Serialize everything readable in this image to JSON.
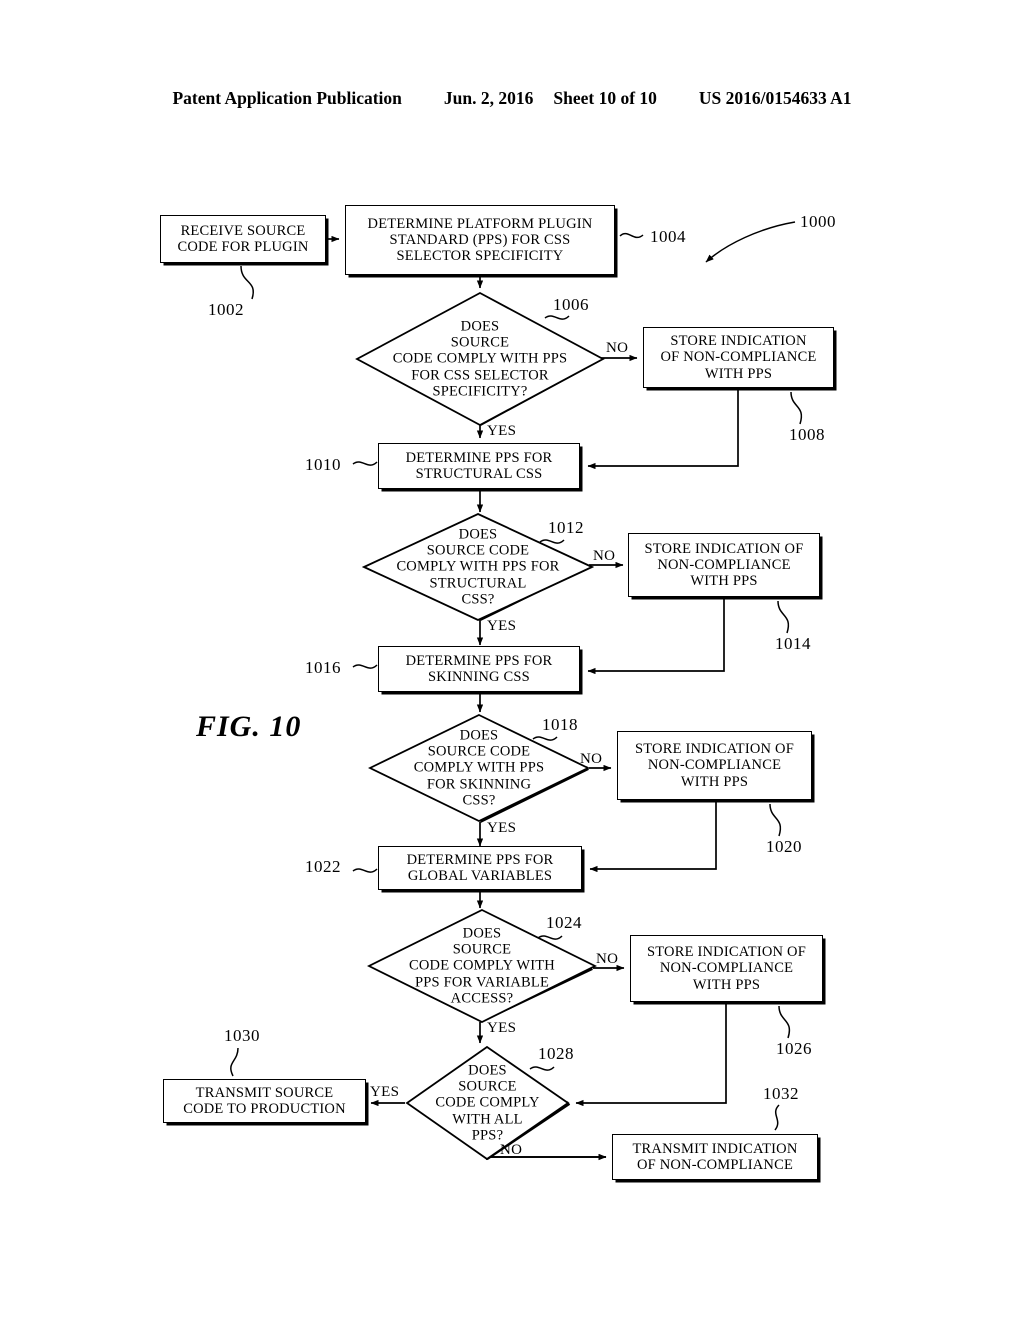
{
  "header": {
    "publication": "Patent Application Publication",
    "date": "Jun. 2, 2016",
    "sheet": "Sheet 10 of 10",
    "patent_number": "US 2016/0154633 A1"
  },
  "figure": {
    "label": "FIG. 10",
    "overall_ref": "1000"
  },
  "nodes": [
    {
      "id": "n1002",
      "ref": "1002",
      "shape": "process",
      "text": "RECEIVE SOURCE\nCODE FOR PLUGIN"
    },
    {
      "id": "n1004",
      "ref": "1004",
      "shape": "process",
      "text": "DETERMINE PLATFORM PLUGIN\nSTANDARD (PPS) FOR CSS\nSELECTOR SPECIFICITY"
    },
    {
      "id": "n1006",
      "ref": "1006",
      "shape": "decision",
      "text": "DOES\nSOURCE\nCODE COMPLY WITH PPS\nFOR CSS SELECTOR\nSPECIFICITY?"
    },
    {
      "id": "n1008",
      "ref": "1008",
      "shape": "process",
      "text": "STORE INDICATION\nOF NON-COMPLIANCE\nWITH PPS"
    },
    {
      "id": "n1010",
      "ref": "1010",
      "shape": "process",
      "text": "DETERMINE PPS FOR\nSTRUCTURAL CSS"
    },
    {
      "id": "n1012",
      "ref": "1012",
      "shape": "decision",
      "text": "DOES\nSOURCE CODE\nCOMPLY WITH PPS FOR\nSTRUCTURAL\nCSS?"
    },
    {
      "id": "n1014",
      "ref": "1014",
      "shape": "process",
      "text": "STORE INDICATION OF\nNON-COMPLIANCE\nWITH PPS"
    },
    {
      "id": "n1016",
      "ref": "1016",
      "shape": "process",
      "text": "DETERMINE PPS FOR\nSKINNING CSS"
    },
    {
      "id": "n1018",
      "ref": "1018",
      "shape": "decision",
      "text": "DOES\nSOURCE CODE\nCOMPLY WITH PPS\nFOR SKINNING\nCSS?"
    },
    {
      "id": "n1020",
      "ref": "1020",
      "shape": "process",
      "text": "STORE INDICATION OF\nNON-COMPLIANCE\nWITH PPS"
    },
    {
      "id": "n1022",
      "ref": "1022",
      "shape": "process",
      "text": "DETERMINE PPS FOR\nGLOBAL VARIABLES"
    },
    {
      "id": "n1024",
      "ref": "1024",
      "shape": "decision",
      "text": "DOES\nSOURCE\nCODE COMPLY WITH\nPPS FOR VARIABLE\nACCESS?"
    },
    {
      "id": "n1026",
      "ref": "1026",
      "shape": "process",
      "text": "STORE INDICATION OF\nNON-COMPLIANCE\nWITH PPS"
    },
    {
      "id": "n1028",
      "ref": "1028",
      "shape": "decision",
      "text": "DOES\nSOURCE\nCODE COMPLY\nWITH ALL\nPPS?"
    },
    {
      "id": "n1030",
      "ref": "1030",
      "shape": "process",
      "text": "TRANSMIT SOURCE\nCODE TO PRODUCTION"
    },
    {
      "id": "n1032",
      "ref": "1032",
      "shape": "process",
      "text": "TRANSMIT INDICATION\nOF NON-COMPLIANCE"
    }
  ],
  "edge_labels": {
    "no_1006": "NO",
    "yes_1006": "YES",
    "no_1012": "NO",
    "yes_1012": "YES",
    "no_1018": "NO",
    "yes_1018": "YES",
    "no_1024": "NO",
    "yes_1024": "YES",
    "yes_1028": "YES",
    "no_1028": "NO"
  },
  "colors": {
    "ink": "#000000",
    "paper": "#ffffff"
  }
}
